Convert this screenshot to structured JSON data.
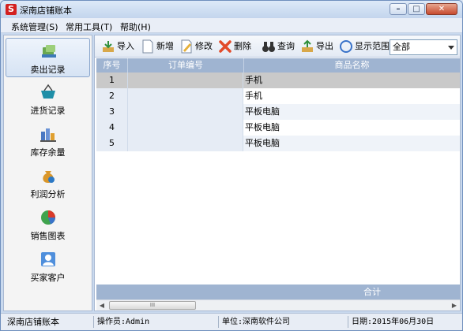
{
  "window": {
    "app_icon_letter": "S",
    "title": "深南店铺账本",
    "buttons": {
      "minimize": "–",
      "maximize": "□",
      "close": "✕"
    }
  },
  "menu": [
    {
      "label": "系统管理(S)"
    },
    {
      "label": "常用工具(T)"
    },
    {
      "label": "帮助(H)"
    }
  ],
  "sidebar": {
    "items": [
      {
        "label": "卖出记录",
        "icon": "sales-icon",
        "active": true
      },
      {
        "label": "进货记录",
        "icon": "purchase-basket-icon",
        "active": false
      },
      {
        "label": "库存余量",
        "icon": "inventory-icon",
        "active": false
      },
      {
        "label": "利润分析",
        "icon": "profit-moneybag-icon",
        "active": false
      },
      {
        "label": "销售图表",
        "icon": "pie-chart-icon",
        "active": false
      },
      {
        "label": "买家客户",
        "icon": "customer-icon",
        "active": false
      }
    ]
  },
  "toolbar": {
    "import_label": "导入",
    "new_label": "新增",
    "edit_label": "修改",
    "delete_label": "删除",
    "query_label": "查询",
    "export_label": "导出",
    "range_label": "显示范围：",
    "range_value": "全部"
  },
  "table": {
    "columns": [
      "序号",
      "订单编号",
      "商品名称"
    ],
    "rows": [
      {
        "index": "1",
        "order_no": "",
        "product": "手机"
      },
      {
        "index": "2",
        "order_no": "",
        "product": "手机"
      },
      {
        "index": "3",
        "order_no": "",
        "product": "平板电脑"
      },
      {
        "index": "4",
        "order_no": "",
        "product": "平板电脑"
      },
      {
        "index": "5",
        "order_no": "",
        "product": "平板电脑"
      }
    ],
    "footer_sum_label": "合计",
    "scroll_thumb_glyph": "III"
  },
  "status": {
    "app_name": "深南店铺账本",
    "operator": "操作员:Admin",
    "company": "单位:深南软件公司",
    "date": "日期:2015年06月30日"
  },
  "colors": {
    "grid_header": "#9fb4d1",
    "selected_row": "#c9c9c9",
    "accent": "#d32020"
  }
}
